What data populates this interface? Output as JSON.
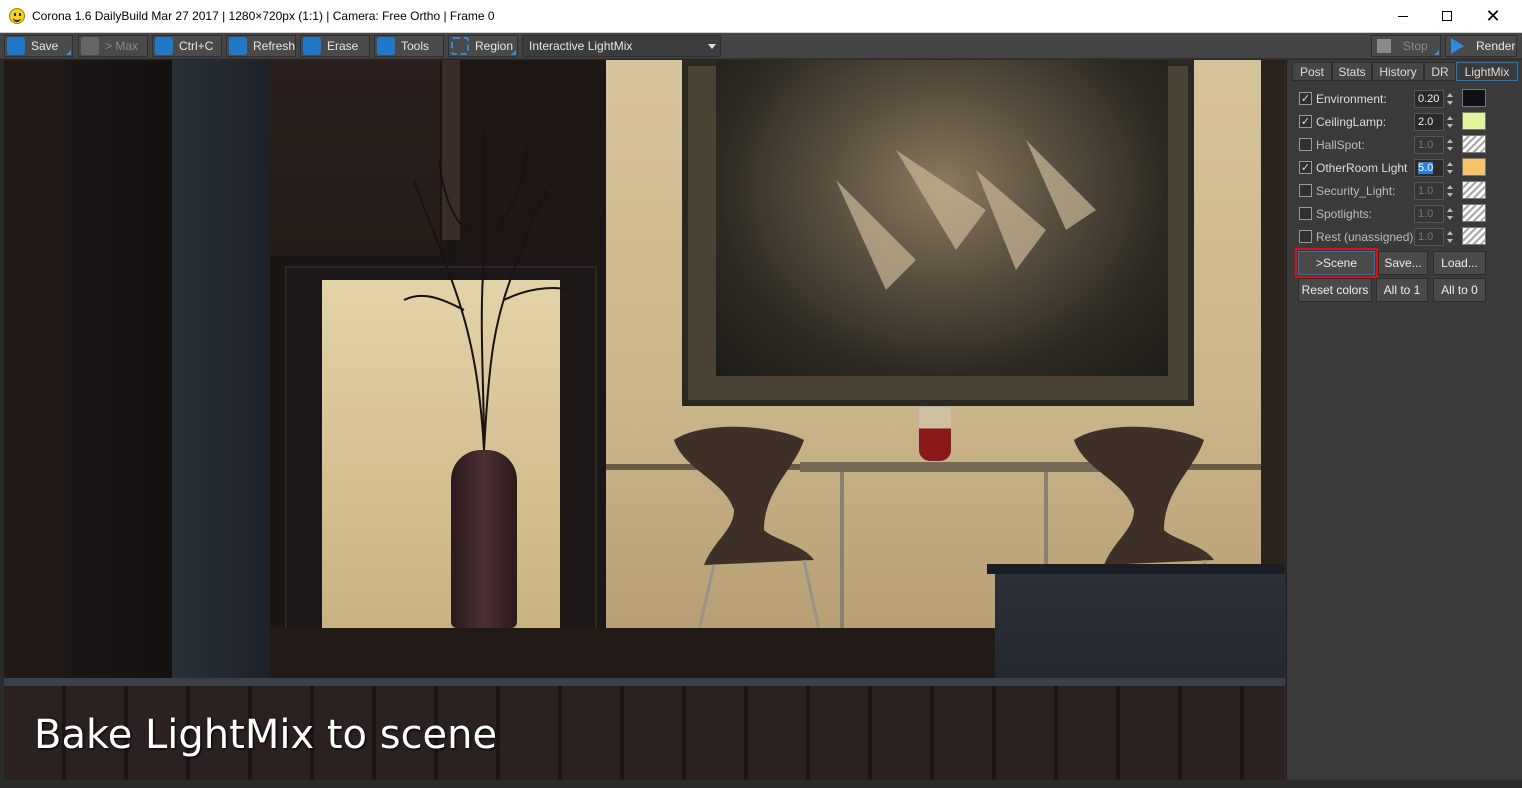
{
  "window": {
    "title": "Corona 1.6 DailyBuild Mar 27 2017 | 1280×720px (1:1) | Camera: Free Ortho | Frame 0",
    "close_glyph": "✕"
  },
  "toolbar": {
    "save": "Save",
    "to_max": "> Max",
    "copy": "Ctrl+C",
    "refresh": "Refresh",
    "erase": "Erase",
    "tools": "Tools",
    "region": "Region",
    "view_selected": "Interactive LightMix",
    "stop": "Stop",
    "render": "Render"
  },
  "panel": {
    "tabs": [
      "Post",
      "Stats",
      "History",
      "DR",
      "LightMix"
    ],
    "active_tab": "LightMix",
    "lights": [
      {
        "label": "Environment:",
        "checked": "✓",
        "value": "0.20",
        "color": "#0d1117",
        "enabled": true
      },
      {
        "label": "CeilingLamp:",
        "checked": "✓",
        "value": "2.0",
        "color": "#e2f59c",
        "enabled": true
      },
      {
        "label": "HallSpot:",
        "checked": "",
        "value": "1.0",
        "color": "",
        "enabled": false
      },
      {
        "label": "OtherRoom Light",
        "checked": "✓",
        "value": "5.0",
        "color": "#f7c469",
        "enabled": true
      },
      {
        "label": "Security_Light:",
        "checked": "",
        "value": "1.0",
        "color": "",
        "enabled": false
      },
      {
        "label": "Spotlights:",
        "checked": "",
        "value": "1.0",
        "color": "",
        "enabled": false
      },
      {
        "label": "Rest (unassigned)",
        "checked": "",
        "value": "1.0",
        "color": "",
        "enabled": false
      }
    ],
    "buttons": {
      "to_scene": ">Scene",
      "save": "Save...",
      "load": "Load...",
      "reset_colors": "Reset colors",
      "all_to_1": "All to 1",
      "all_to_0": "All to 0"
    }
  },
  "viewport": {
    "caption": "Bake LightMix to scene"
  },
  "colors": {
    "accent": "#1f78c8",
    "highlight": "#e01010"
  }
}
